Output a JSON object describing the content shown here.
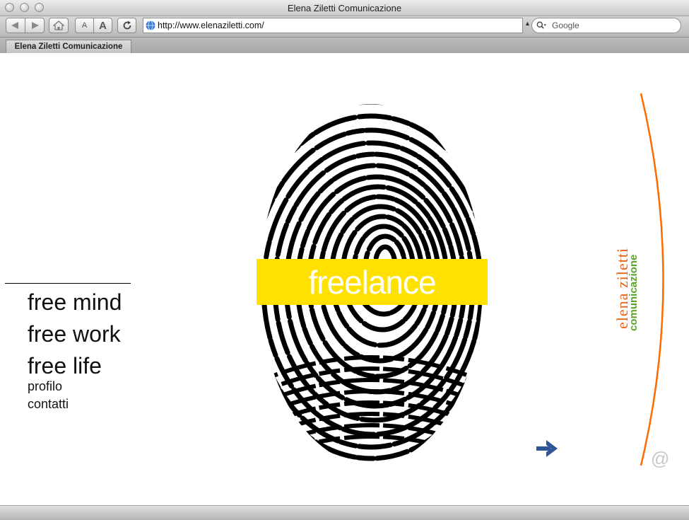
{
  "window": {
    "title": "Elena Ziletti Comunicazione"
  },
  "toolbar": {
    "back_icon": "back-arrow-icon",
    "forward_icon": "forward-arrow-icon",
    "home_icon": "home-icon",
    "text_smaller": "A",
    "text_bigger": "A",
    "reload_icon": "reload-icon",
    "url": "http://www.elenaziletti.com/",
    "search_placeholder": "Google"
  },
  "tabs": [
    {
      "label": "Elena Ziletti Comunicazione"
    }
  ],
  "page": {
    "menu": [
      "free mind",
      "free work",
      "free life"
    ],
    "links": [
      "profilo",
      "contatti"
    ],
    "banner_text": "freelance",
    "brand_name": "elena  ziletti",
    "brand_sub": "comunicazione",
    "at_symbol": "@"
  },
  "colors": {
    "banner": "#ffe100",
    "brand_orange": "#e8631a",
    "brand_green": "#5ca32d",
    "arrow_blue": "#2f5598",
    "arc_orange": "#ff6a00"
  }
}
